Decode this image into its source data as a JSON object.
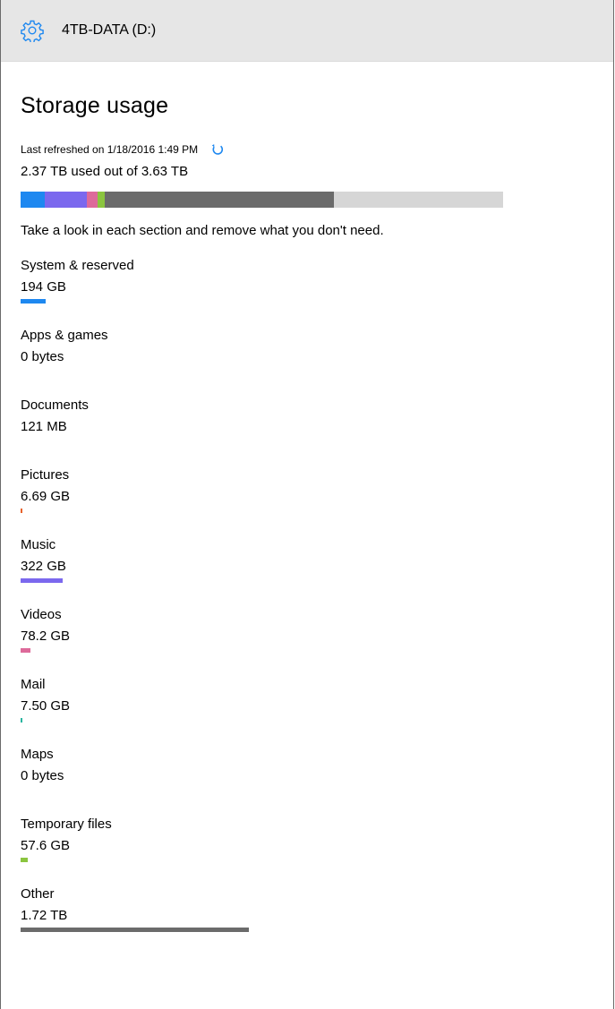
{
  "titlebar": {
    "title": "4TB-DATA (D:)",
    "icon": "gear-icon"
  },
  "page": {
    "title": "Storage usage",
    "refreshed": "Last refreshed on 1/18/2016 1:49 PM",
    "used_text": "2.37 TB used out of 3.63 TB",
    "hint": "Take a look in each section and remove what you don't need."
  },
  "colors": {
    "system": "#1e88f0",
    "music": "#7b68ee",
    "videos": "#dd6a9a",
    "temp": "#8bc53f",
    "mail": "#2ab5a0",
    "pictures": "#e8622c",
    "other": "#6b6b6b",
    "free": "#d6d6d6",
    "accent": "#1e88f0"
  },
  "total_bar": [
    {
      "key": "system",
      "fraction": 0.051
    },
    {
      "key": "music",
      "fraction": 0.087
    },
    {
      "key": "videos",
      "fraction": 0.021
    },
    {
      "key": "temp",
      "fraction": 0.016
    },
    {
      "key": "other",
      "fraction": 0.474
    }
  ],
  "categories": [
    {
      "name": "System & reserved",
      "size": "194 GB",
      "color": "system",
      "fraction": 0.11
    },
    {
      "name": "Apps & games",
      "size": "0 bytes",
      "color": "system",
      "fraction": 0
    },
    {
      "name": "Documents",
      "size": "121 MB",
      "color": "system",
      "fraction": 0
    },
    {
      "name": "Pictures",
      "size": "6.69 GB",
      "color": "pictures",
      "fraction": 0.004
    },
    {
      "name": "Music",
      "size": "322 GB",
      "color": "music",
      "fraction": 0.183
    },
    {
      "name": "Videos",
      "size": "78.2 GB",
      "color": "videos",
      "fraction": 0.044
    },
    {
      "name": "Mail",
      "size": "7.50 GB",
      "color": "mail",
      "fraction": 0.004
    },
    {
      "name": "Maps",
      "size": "0 bytes",
      "color": "system",
      "fraction": 0
    },
    {
      "name": "Temporary files",
      "size": "57.6 GB",
      "color": "temp",
      "fraction": 0.033
    },
    {
      "name": "Other",
      "size": "1.72 TB",
      "color": "other",
      "fraction": 1.0
    }
  ]
}
